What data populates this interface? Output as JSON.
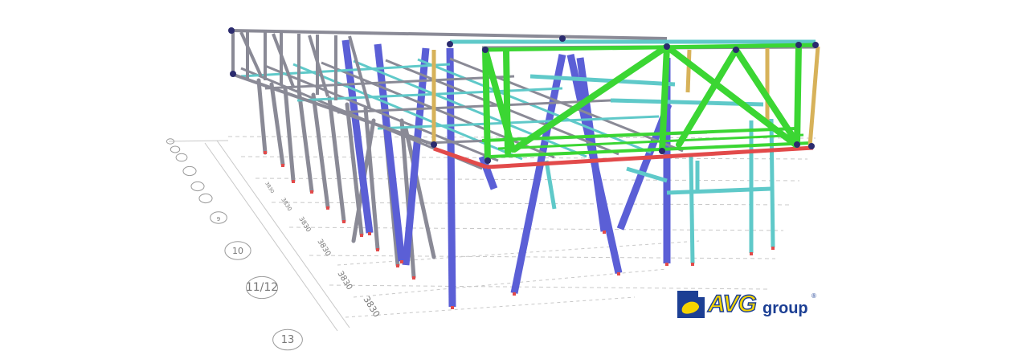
{
  "figure": {
    "axis_bubbles": [
      "13",
      "11/12",
      "10",
      "9",
      "8",
      "7",
      "6",
      "5",
      "4",
      "3"
    ],
    "dimension_labels": [
      "3830",
      "3830",
      "3830",
      "3830",
      "3830",
      "3830"
    ],
    "colors": {
      "grid": "#c8c8c8",
      "column_blue": "#5b5fd6",
      "column_gray": "#8a8a96",
      "truss_green": "#3bd633",
      "beam_cyan": "#5fc9c9",
      "beam_red": "#e24a4a",
      "beam_gold": "#d7b25a",
      "node_dark": "#2b2b6e"
    }
  },
  "logo": {
    "brand": "AVG",
    "suffix": "group",
    "registered": "®",
    "colors": {
      "blue": "#1c3f94",
      "yellow": "#f5d400"
    }
  }
}
